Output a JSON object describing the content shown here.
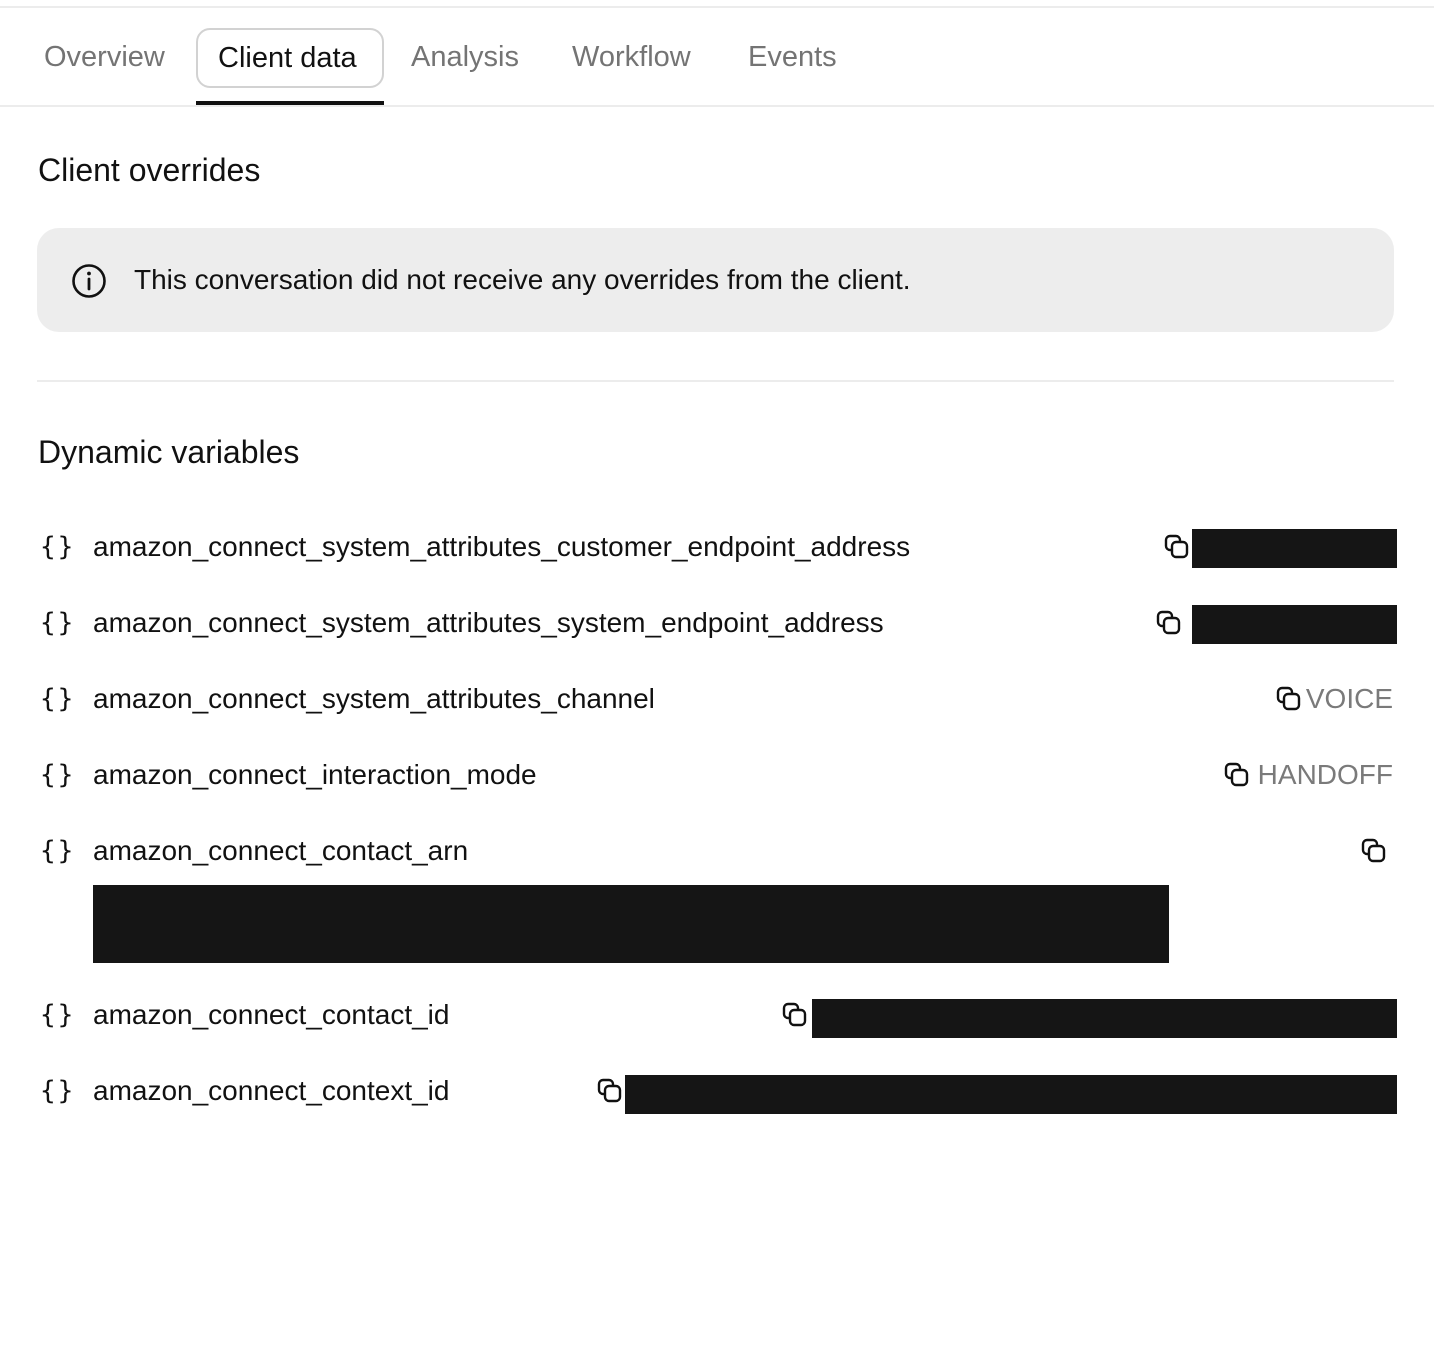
{
  "tabs": [
    {
      "label": "Overview",
      "active": false
    },
    {
      "label": "Client data",
      "active": true
    },
    {
      "label": "Analysis",
      "active": false
    },
    {
      "label": "Workflow",
      "active": false
    },
    {
      "label": "Events",
      "active": false
    }
  ],
  "client_overrides": {
    "title": "Client overrides",
    "notice_icon": "info-icon",
    "notice_text": "This conversation did not receive any overrides from the client."
  },
  "dynamic_variables": {
    "title": "Dynamic variables",
    "brace_glyph": "{}",
    "items": [
      {
        "name": "amazon_connect_system_attributes_customer_endpoint_address",
        "value": null,
        "redacted": true,
        "icon": "copy-icon"
      },
      {
        "name": "amazon_connect_system_attributes_system_endpoint_address",
        "value": null,
        "redacted": true,
        "icon": "copy-icon"
      },
      {
        "name": "amazon_connect_system_attributes_channel",
        "value": "VOICE",
        "redacted": false,
        "icon": "copy-icon"
      },
      {
        "name": "amazon_connect_interaction_mode",
        "value": "HANDOFF",
        "redacted": false,
        "icon": "copy-icon"
      },
      {
        "name": "amazon_connect_contact_arn",
        "value": null,
        "redacted": true,
        "icon": "copy-icon"
      },
      {
        "name": "amazon_connect_contact_id",
        "value": null,
        "redacted": true,
        "icon": "copy-icon"
      },
      {
        "name": "amazon_connect_context_id",
        "value": null,
        "redacted": true,
        "icon": "copy-icon"
      }
    ]
  },
  "colors": {
    "text": "#111111",
    "muted_text": "#747474",
    "value_text": "#7a7a7a",
    "notice_bg": "#ededed",
    "redaction": "#151515",
    "divider": "#ececec"
  }
}
